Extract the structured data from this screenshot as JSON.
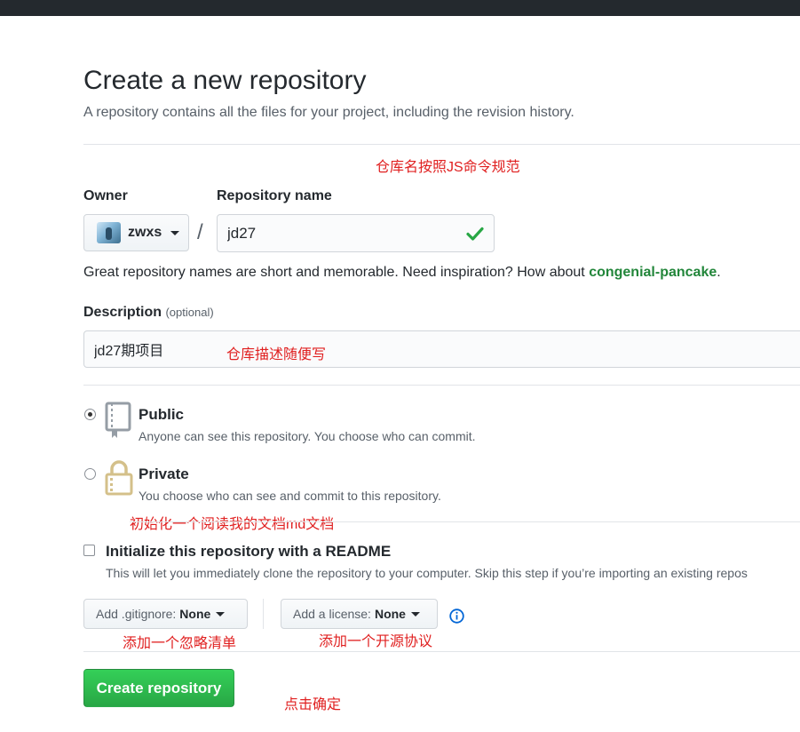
{
  "header": {
    "title": "Create a new repository",
    "subtitle": "A repository contains all the files for your project, including the revision history."
  },
  "annotations": {
    "repo_name_note": "仓库名按照JS命令规范",
    "description_note": "仓库描述随便写",
    "readme_note": "初始化一个阅读我的文档md文档",
    "gitignore_note": "添加一个忽略清单",
    "license_note": "添加一个开源协议",
    "create_note": "点击确定"
  },
  "owner": {
    "label": "Owner",
    "name": "zwxs"
  },
  "repo": {
    "label": "Repository name",
    "value": "jd27",
    "valid_icon": "check-icon",
    "hint_prefix": "Great repository names are short and memorable. Need inspiration? How about ",
    "suggestion": "congenial-pancake",
    "hint_suffix": "."
  },
  "description": {
    "label": "Description",
    "optional": "(optional)",
    "value": "jd27期项目"
  },
  "visibility": {
    "public": {
      "title": "Public",
      "note": "Anyone can see this repository. You choose who can commit.",
      "icon": "repo-book-icon",
      "checked": true
    },
    "private": {
      "title": "Private",
      "note": "You choose who can see and commit to this repository.",
      "icon": "lock-icon",
      "checked": false
    }
  },
  "readme": {
    "label": "Initialize this repository with a README",
    "note": "This will let you immediately clone the repository to your computer. Skip this step if you’re importing an existing repos",
    "checked": false
  },
  "gitignore": {
    "label": "Add .gitignore:",
    "value": "None"
  },
  "license": {
    "label": "Add a license:",
    "value": "None",
    "info_icon": "info-icon"
  },
  "create_button": {
    "label": "Create repository"
  },
  "colors": {
    "topbar": "#24292e",
    "annotation": "#e02020",
    "create_button": "#28a745",
    "suggestion": "#22863a",
    "info": "#0366d6"
  }
}
